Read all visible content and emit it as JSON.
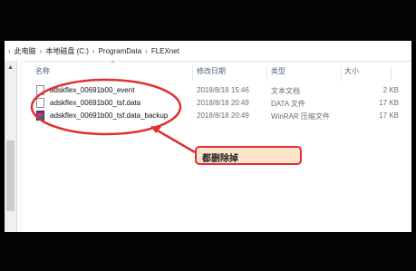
{
  "breadcrumb": [
    "此电脑",
    "本地磁盘 (C:)",
    "ProgramData",
    "FLEXnet"
  ],
  "columns": {
    "name": "名称",
    "date": "修改日期",
    "type": "类型",
    "size": "大小"
  },
  "files": [
    {
      "name": "adskflex_00691b00_event",
      "date": "2018/8/18 15:46",
      "type": "文本文档",
      "size": "2 KB",
      "icon": "text-file-icon"
    },
    {
      "name": "adskflex_00691b00_tsf.data",
      "date": "2018/8/18 20:49",
      "type": "DATA 文件",
      "size": "17 KB",
      "icon": "data-file-icon"
    },
    {
      "name": "adskflex_00691b00_tsf.data_backup",
      "date": "2018/8/18 20:49",
      "type": "WinRAR 压缩文件",
      "size": "17 KB",
      "icon": "winrar-archive-icon"
    }
  ],
  "annotation": {
    "label": "都删除掉",
    "color": "#e03030",
    "fill": "#fbe3cc"
  }
}
